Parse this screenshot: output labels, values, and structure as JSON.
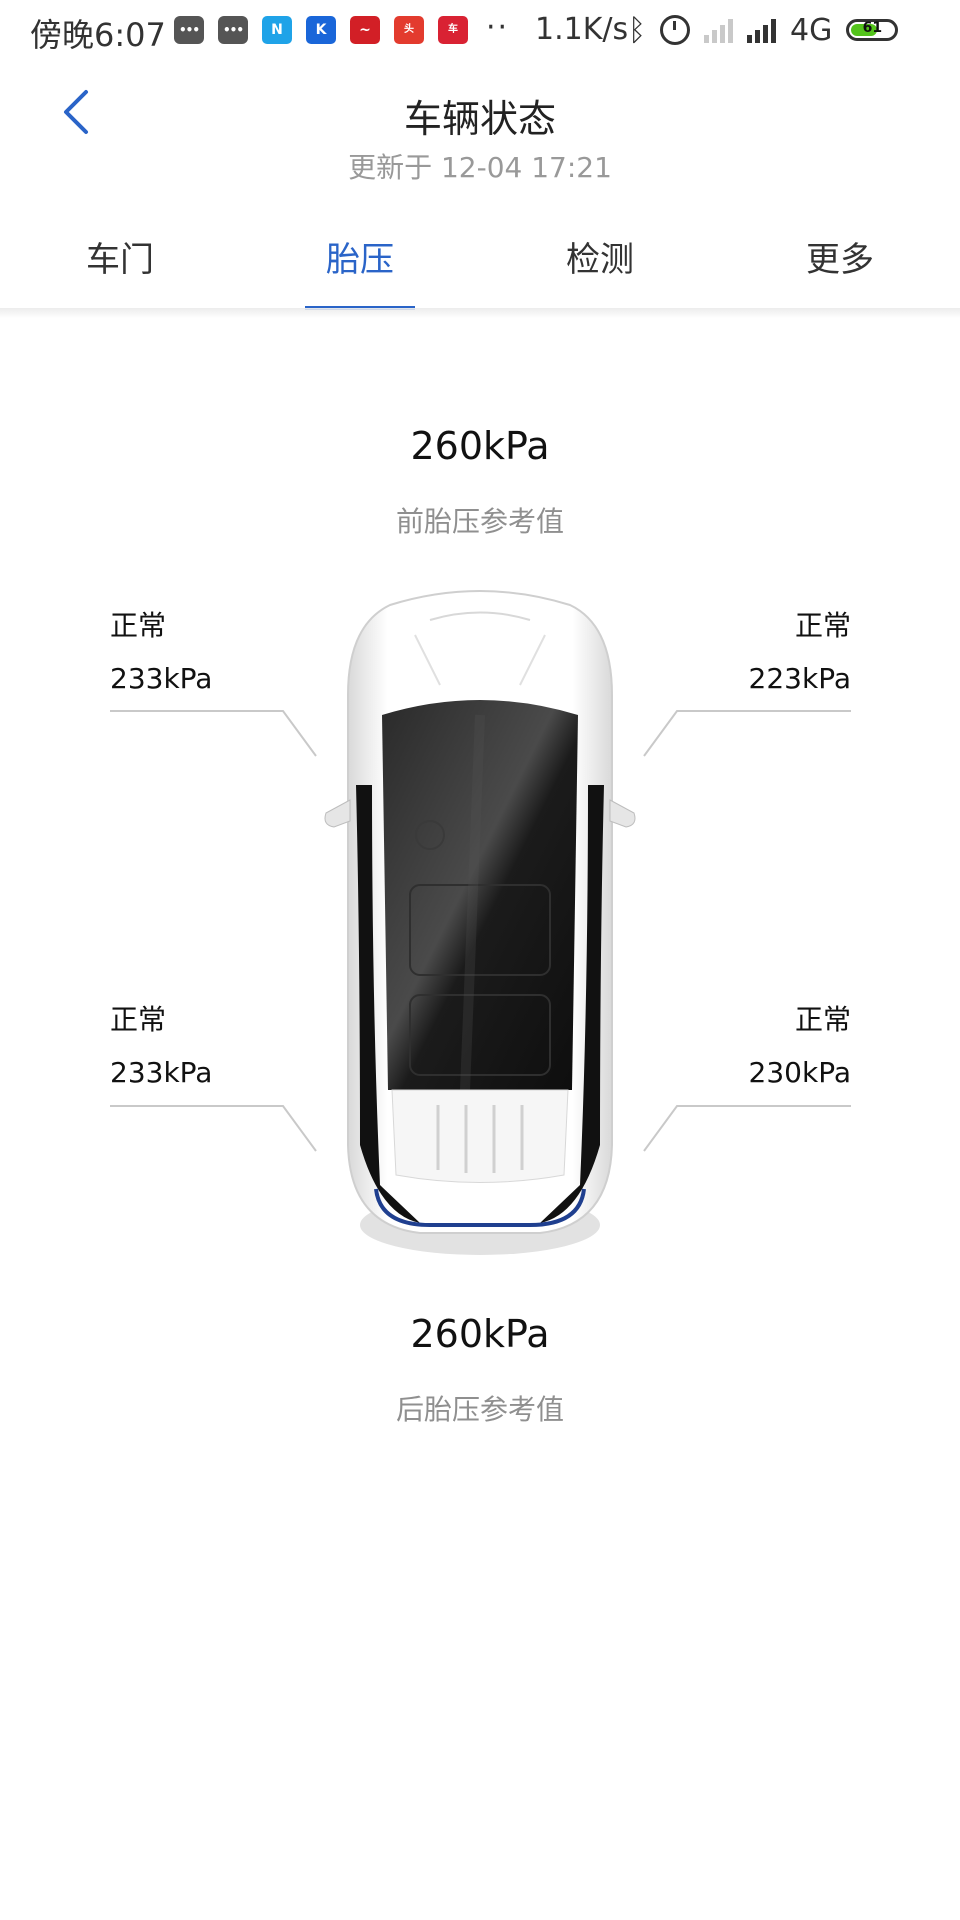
{
  "status_bar": {
    "time": "傍晚6:07",
    "more": "··",
    "network_speed": "1.1K/s",
    "network_type": "4G",
    "battery": "61",
    "notifications": [
      {
        "icon": "message-icon"
      },
      {
        "icon": "message-icon"
      },
      {
        "icon": "n-app-icon"
      },
      {
        "icon": "k-app-icon"
      },
      {
        "icon": "stock-app-icon"
      },
      {
        "icon": "toutiao-app-icon"
      },
      {
        "icon": "qiche-app-icon"
      }
    ],
    "colors": {
      "battery_fill": "#53c31b"
    }
  },
  "header": {
    "title": "车辆状态",
    "subtitle": "更新于 12-04 17:21"
  },
  "tabs": [
    {
      "label": "车门"
    },
    {
      "label": "胎压",
      "active": true
    },
    {
      "label": "检测"
    },
    {
      "label": "更多"
    }
  ],
  "front_reference": {
    "value": "260kPa",
    "label": "前胎压参考值"
  },
  "rear_reference": {
    "value": "260kPa",
    "label": "后胎压参考值"
  },
  "tires": {
    "front_left": {
      "status": "正常",
      "pressure": "233kPa"
    },
    "front_right": {
      "status": "正常",
      "pressure": "223kPa"
    },
    "rear_left": {
      "status": "正常",
      "pressure": "233kPa"
    },
    "rear_right": {
      "status": "正常",
      "pressure": "230kPa"
    }
  },
  "colors": {
    "accent": "#2a64c8",
    "muted_text": "#999999",
    "tire_highlight": "#3f6fcf"
  }
}
